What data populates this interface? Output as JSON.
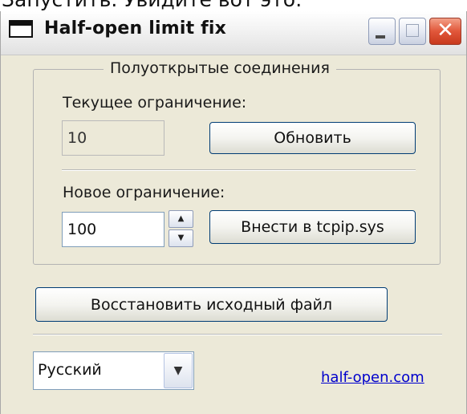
{
  "caption_above": "Запустить. Увидите вот это:",
  "window": {
    "title": "Half-open limit fix",
    "controls": {
      "close_glyph": "✕"
    }
  },
  "group": {
    "legend": "Полуоткрытые соединения",
    "current_limit_label": "Текущее ограничение:",
    "current_limit_value": "10",
    "refresh_label": "Обновить",
    "new_limit_label": "Новое ограничение:",
    "new_limit_value": "100",
    "apply_label": "Внести в tcpip.sys"
  },
  "restore_label": "Восстановить исходный файл",
  "language": {
    "selected": "Русский"
  },
  "link_text": "half-open.com",
  "icons": {
    "app": "window-icon",
    "spin_up": "arrow-up-icon",
    "spin_down": "arrow-down-icon",
    "combo": "chevron-down-icon"
  },
  "colors": {
    "window_bg": "#ece9d8",
    "close_button": "#e1573a",
    "link": "#0000cc"
  }
}
